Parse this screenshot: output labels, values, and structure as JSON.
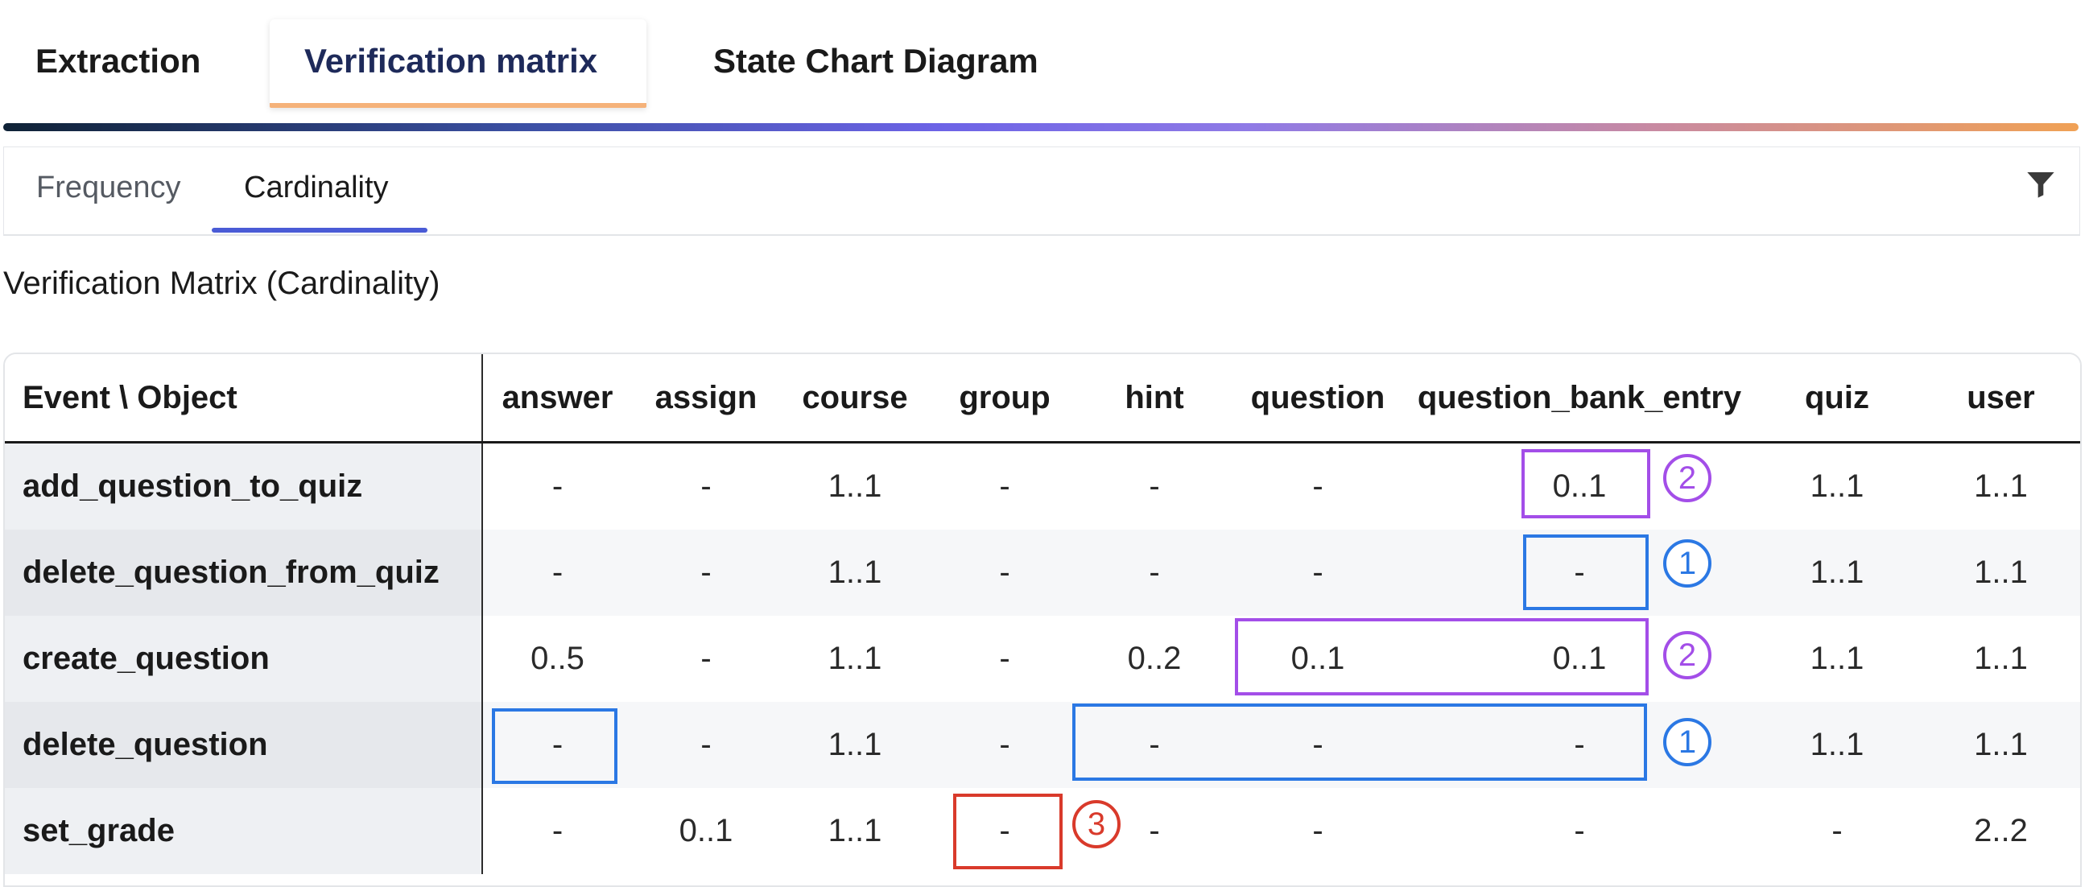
{
  "top_tabs": [
    {
      "label": "Extraction",
      "active": false
    },
    {
      "label": "Verification matrix",
      "active": true
    },
    {
      "label": "State Chart Diagram",
      "active": false
    }
  ],
  "sub_tabs": [
    {
      "label": "Frequency",
      "active": false
    },
    {
      "label": "Cardinality",
      "active": true
    }
  ],
  "filter_icon": "filter-icon",
  "matrix_title": "Verification Matrix (Cardinality)",
  "table": {
    "corner": "Event \\ Object",
    "columns": [
      "answer",
      "assign",
      "course",
      "group",
      "hint",
      "question",
      "question_bank_entry",
      "quiz",
      "user"
    ],
    "rows": [
      {
        "event": "add_question_to_quiz",
        "cells": [
          "-",
          "-",
          "1..1",
          "-",
          "-",
          "-",
          "0..1",
          "1..1",
          "1..1"
        ]
      },
      {
        "event": "delete_question_from_quiz",
        "cells": [
          "-",
          "-",
          "1..1",
          "-",
          "-",
          "-",
          "-",
          "1..1",
          "1..1"
        ]
      },
      {
        "event": "create_question",
        "cells": [
          "0..5",
          "-",
          "1..1",
          "-",
          "0..2",
          "0..1",
          "0..1",
          "1..1",
          "1..1"
        ]
      },
      {
        "event": "delete_question",
        "cells": [
          "-",
          "-",
          "1..1",
          "-",
          "-",
          "-",
          "-",
          "1..1",
          "1..1"
        ]
      },
      {
        "event": "set_grade",
        "cells": [
          "-",
          "0..1",
          "1..1",
          "-",
          "-",
          "-",
          "-",
          "-",
          "2..2"
        ]
      }
    ]
  },
  "annotations": {
    "colors": {
      "blue": "#2b78e4",
      "purple": "#a34ee8",
      "red": "#d93a2b"
    },
    "badges": [
      "2",
      "1",
      "2",
      "1",
      "3"
    ]
  }
}
